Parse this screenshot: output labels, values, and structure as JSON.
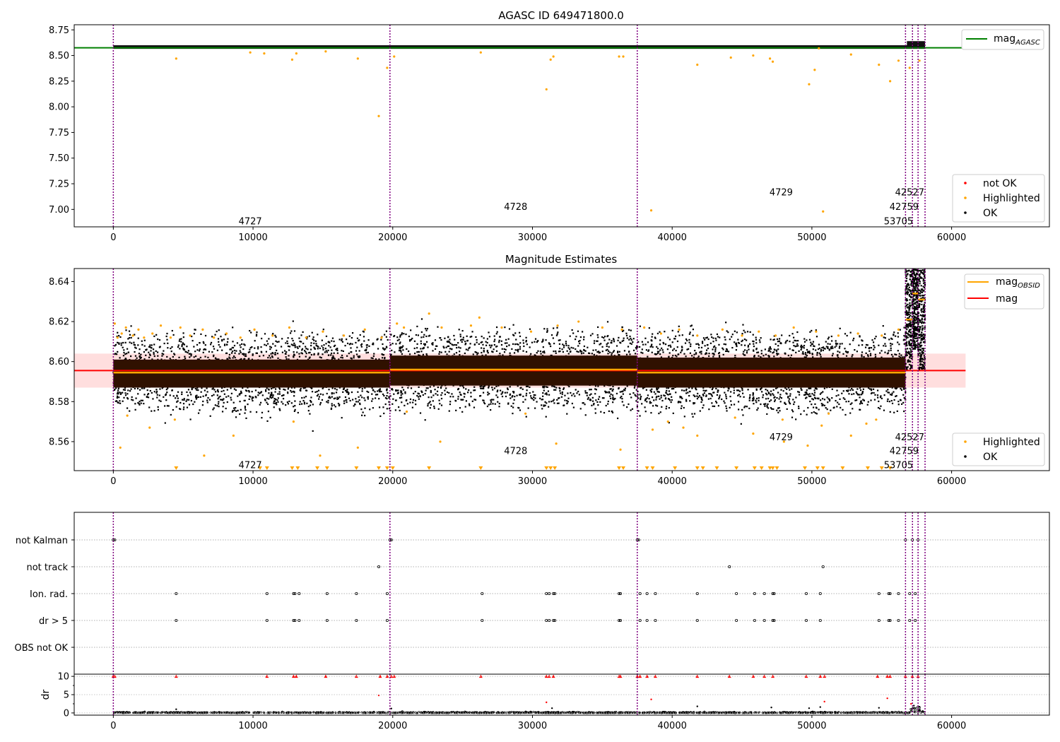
{
  "chart_data": [
    {
      "type": "scatter",
      "title": "AGASC ID 649471800.0",
      "xlim": [
        -2800,
        67000
      ],
      "ylim": [
        6.83,
        8.8
      ],
      "xticks": [
        0,
        10000,
        20000,
        30000,
        40000,
        50000,
        60000
      ],
      "yticks": [
        7.0,
        7.25,
        7.5,
        7.75,
        8.0,
        8.25,
        8.5,
        8.75
      ],
      "ytick_labels": [
        "7.00",
        "7.25",
        "7.50",
        "7.75",
        "8.00",
        "8.25",
        "8.50",
        "8.75"
      ],
      "hline": {
        "name": "mag",
        "sub": "AGASC",
        "y": 8.575,
        "x_range": [
          -2800,
          61000
        ],
        "color": "#008000"
      },
      "ok_band": {
        "x_range": [
          0,
          58100
        ],
        "y_range": [
          8.565,
          8.6
        ]
      },
      "late_band": {
        "x_range": [
          56800,
          58100
        ],
        "y_range": [
          8.59,
          8.64
        ]
      },
      "highlighted_points": {
        "x": [
          4500,
          9800,
          10800,
          12800,
          13100,
          15200,
          17500,
          19000,
          19600,
          20100,
          26300,
          31000,
          31300,
          31500,
          36200,
          36500,
          38500,
          41800,
          44200,
          45800,
          47000,
          47200,
          49800,
          50200,
          50500,
          50800,
          52800,
          54800,
          55600,
          56200,
          57000,
          57700
        ],
        "y": [
          8.47,
          8.53,
          8.52,
          8.46,
          8.52,
          8.54,
          8.47,
          7.91,
          8.38,
          8.49,
          8.53,
          8.17,
          8.46,
          8.49,
          8.49,
          8.49,
          6.99,
          8.41,
          8.48,
          8.5,
          8.47,
          8.44,
          8.22,
          8.36,
          8.57,
          6.98,
          8.51,
          8.41,
          8.25,
          8.45,
          8.38,
          8.45
        ]
      },
      "obsid_lines": [
        0,
        19800,
        37500,
        56700,
        57200,
        57600,
        58100
      ],
      "obsid_labels": [
        {
          "text": "4727",
          "x": 9800,
          "y": 6.89
        },
        {
          "text": "4728",
          "x": 28800,
          "y": 7.03
        },
        {
          "text": "4729",
          "x": 47800,
          "y": 7.17
        },
        {
          "text": "42527",
          "x": 57000,
          "y": 7.17
        },
        {
          "text": "42759",
          "x": 56600,
          "y": 7.03
        },
        {
          "text": "53705",
          "x": 56200,
          "y": 6.89
        }
      ],
      "legends": [
        {
          "position": "top-right",
          "items": [
            {
              "kind": "line",
              "color": "#008000",
              "label": "mag",
              "sub": "AGASC"
            }
          ]
        },
        {
          "position": "bottom-right",
          "items": [
            {
              "kind": "dot",
              "color": "#ff0000",
              "label": "not OK"
            },
            {
              "kind": "dot",
              "color": "#ffa500",
              "label": "Highlighted"
            },
            {
              "kind": "dot",
              "color": "#000000",
              "label": "OK"
            }
          ]
        }
      ]
    },
    {
      "type": "scatter",
      "title": "Magnitude Estimates",
      "xlim": [
        -2800,
        67000
      ],
      "ylim": [
        8.5455,
        8.6465
      ],
      "xticks": [
        0,
        10000,
        20000,
        30000,
        40000,
        50000,
        60000
      ],
      "yticks": [
        8.56,
        8.58,
        8.6,
        8.62,
        8.64
      ],
      "ytick_labels": [
        "8.56",
        "8.58",
        "8.60",
        "8.62",
        "8.64"
      ],
      "mag": {
        "name": "mag",
        "y": 8.5955,
        "band": [
          8.587,
          8.604
        ],
        "x_range": [
          -2800,
          61000
        ],
        "color": "#ff0000"
      },
      "ok_scatter": {
        "x_range": [
          0,
          56700
        ],
        "y_center": 8.5955,
        "y_spread": 0.031
      },
      "obsid_segments": [
        {
          "x": [
            0,
            19800
          ],
          "mag": 8.5945,
          "band": [
            8.587,
            8.601
          ]
        },
        {
          "x": [
            19800,
            37500
          ],
          "mag": 8.596,
          "band": [
            8.588,
            8.603
          ]
        },
        {
          "x": [
            37500,
            56700
          ],
          "mag": 8.5945,
          "band": [
            8.587,
            8.602
          ]
        },
        {
          "x": [
            56700,
            57200
          ],
          "mag": 8.621,
          "band": [
            8.6,
            8.646
          ]
        },
        {
          "x": [
            57200,
            57600
          ],
          "mag": 8.634,
          "band": [
            8.61,
            8.646
          ]
        },
        {
          "x": [
            57600,
            58100
          ],
          "mag": 8.631,
          "band": [
            8.6,
            8.646
          ]
        }
      ],
      "highlighted_points": {
        "x": [
          100,
          300,
          600,
          900,
          1400,
          1800,
          2200,
          2800,
          3400,
          4100,
          4800,
          5500,
          6400,
          7200,
          8100,
          9100,
          10100,
          11400,
          12600,
          13800,
          15000,
          16500,
          18000,
          19200,
          20300,
          20800,
          22600,
          23500,
          25600,
          26200,
          27800,
          29900,
          31800,
          33300,
          35000,
          36400,
          38000,
          39200,
          40500,
          41800,
          43600,
          45000,
          46200,
          47400,
          48700,
          50300,
          51900,
          53300,
          55000,
          56200,
          500,
          6500,
          8600,
          14800,
          17500,
          23400,
          31700,
          36300,
          38600,
          40800,
          41800,
          45800,
          48000,
          49700,
          50700,
          52800,
          54600,
          1000,
          2600,
          4400,
          12900,
          21000,
          29500,
          39700,
          44500,
          47900,
          51200,
          53900
        ],
        "y": [
          8.619,
          8.612,
          8.614,
          8.617,
          8.613,
          8.616,
          8.612,
          8.614,
          8.618,
          8.612,
          8.617,
          8.613,
          8.616,
          8.612,
          8.614,
          8.612,
          8.616,
          8.613,
          8.617,
          8.612,
          8.615,
          8.613,
          8.616,
          8.612,
          8.619,
          8.617,
          8.624,
          8.617,
          8.618,
          8.622,
          8.617,
          8.615,
          8.618,
          8.62,
          8.617,
          8.616,
          8.617,
          8.614,
          8.616,
          8.613,
          8.616,
          8.613,
          8.615,
          8.613,
          8.617,
          8.615,
          8.613,
          8.614,
          8.613,
          8.616,
          8.557,
          8.553,
          8.563,
          8.553,
          8.557,
          8.56,
          8.559,
          8.556,
          8.566,
          8.567,
          8.563,
          8.564,
          8.56,
          8.558,
          8.568,
          8.563,
          8.571,
          8.573,
          8.567,
          8.571,
          8.57,
          8.575,
          8.574,
          8.57,
          8.572,
          8.571,
          8.574,
          8.569
        ]
      },
      "clipped_markers_x": [
        4500,
        10500,
        11000,
        12800,
        13200,
        14600,
        15300,
        17400,
        19000,
        19600,
        20000,
        22600,
        26300,
        31000,
        31300,
        31600,
        36200,
        36500,
        38200,
        38600,
        40200,
        41800,
        42200,
        43200,
        44600,
        45900,
        46400,
        47000,
        47200,
        47500,
        49500,
        50400,
        50800,
        52200,
        54000,
        55000,
        55600
      ],
      "obsid_lines": [
        0,
        19800,
        37500,
        56700,
        57200,
        57600,
        58100
      ],
      "obsid_labels": [
        {
          "text": "4727",
          "x": 9800,
          "y": 8.5485
        },
        {
          "text": "4728",
          "x": 28800,
          "y": 8.5555
        },
        {
          "text": "4729",
          "x": 47800,
          "y": 8.5625
        },
        {
          "text": "42527",
          "x": 57000,
          "y": 8.5625
        },
        {
          "text": "42759",
          "x": 56600,
          "y": 8.5555
        },
        {
          "text": "53705",
          "x": 56200,
          "y": 8.5485
        }
      ],
      "legends": [
        {
          "position": "top-right",
          "items": [
            {
              "kind": "line",
              "color": "#ffa500",
              "label": "mag",
              "sub": "OBSID"
            },
            {
              "kind": "line",
              "color": "#ff0000",
              "label": "mag"
            }
          ]
        },
        {
          "position": "bottom-right",
          "items": [
            {
              "kind": "dot",
              "color": "#ffa500",
              "label": "Highlighted"
            },
            {
              "kind": "dot",
              "color": "#000000",
              "label": "OK"
            }
          ]
        }
      ]
    },
    {
      "type": "scatter",
      "title": "",
      "xlim": [
        -2800,
        67000
      ],
      "categories": [
        "not Kalman",
        "not track",
        "Ion. rad.",
        "dr > 5",
        "OBS not OK"
      ],
      "flags": [
        {
          "category": "not Kalman",
          "x": [
            0,
            100,
            19800,
            19900,
            37500,
            37600,
            56700,
            57200,
            57600
          ]
        },
        {
          "category": "not track",
          "x": [
            19000,
            44100,
            50800
          ]
        },
        {
          "category": "Ion. rad.",
          "x": [
            4500,
            11000,
            12900,
            13000,
            13300,
            15300,
            17400,
            19600,
            26400,
            31000,
            31200,
            31500,
            31600,
            36200,
            36300,
            37700,
            38200,
            38800,
            41800,
            44600,
            45900,
            46600,
            47200,
            47300,
            49600,
            50600,
            54800,
            55500,
            55600,
            56200,
            57000,
            57400
          ]
        },
        {
          "category": "dr > 5",
          "x": [
            4500,
            11000,
            12900,
            13000,
            13300,
            15300,
            17400,
            19600,
            26400,
            31000,
            31200,
            31500,
            31600,
            36200,
            36300,
            37700,
            38200,
            38800,
            41800,
            44600,
            45900,
            46600,
            47200,
            47300,
            49600,
            50600,
            54800,
            55500,
            55600,
            56200,
            57000,
            57400
          ]
        },
        {
          "category": "OBS not OK",
          "x": []
        }
      ],
      "obsid_lines": [
        0,
        19800,
        37500,
        56700,
        57200,
        57600,
        58100
      ]
    },
    {
      "type": "scatter",
      "title": "",
      "ylabel": "dr",
      "xlim": [
        -2800,
        67000
      ],
      "ylim": [
        -0.6,
        10.6
      ],
      "xticks": [
        0,
        10000,
        20000,
        30000,
        40000,
        50000,
        60000
      ],
      "xtick_labels": [
        "0",
        "10000",
        "20000",
        "30000",
        "40000",
        "50000",
        "60000"
      ],
      "yticks": [
        0,
        5,
        10
      ],
      "ytick_labels": [
        "0",
        "5",
        "10"
      ],
      "minor_yticks": [
        2.5,
        7.5
      ],
      "baseline_range": [
        0,
        58100
      ],
      "clipped_red_x": [
        0,
        100,
        4500,
        11000,
        12900,
        13100,
        15200,
        17400,
        19100,
        19600,
        19900,
        20100,
        26300,
        31000,
        31200,
        31500,
        36200,
        36300,
        37500,
        37700,
        38200,
        38800,
        41800,
        44100,
        45800,
        46600,
        47200,
        49600,
        50600,
        50900,
        54700,
        55400,
        55600,
        56700,
        57200,
        57600
      ],
      "red_points": {
        "x": [
          19000,
          31000,
          38500,
          50900,
          55400,
          57100
        ],
        "y": [
          4.8,
          2.9,
          3.7,
          3.1,
          4.0,
          2.5
        ]
      },
      "black_points": {
        "x": [
          4500,
          19900,
          31400,
          41800,
          47100,
          49800,
          50600,
          54800,
          57300,
          57700
        ],
        "y": [
          1.0,
          1.2,
          1.3,
          1.8,
          1.5,
          1.3,
          1.6,
          1.4,
          2.0,
          1.7
        ]
      },
      "obsid_lines": [
        0,
        19800,
        37500,
        56700,
        57200,
        57600,
        58100
      ]
    }
  ]
}
